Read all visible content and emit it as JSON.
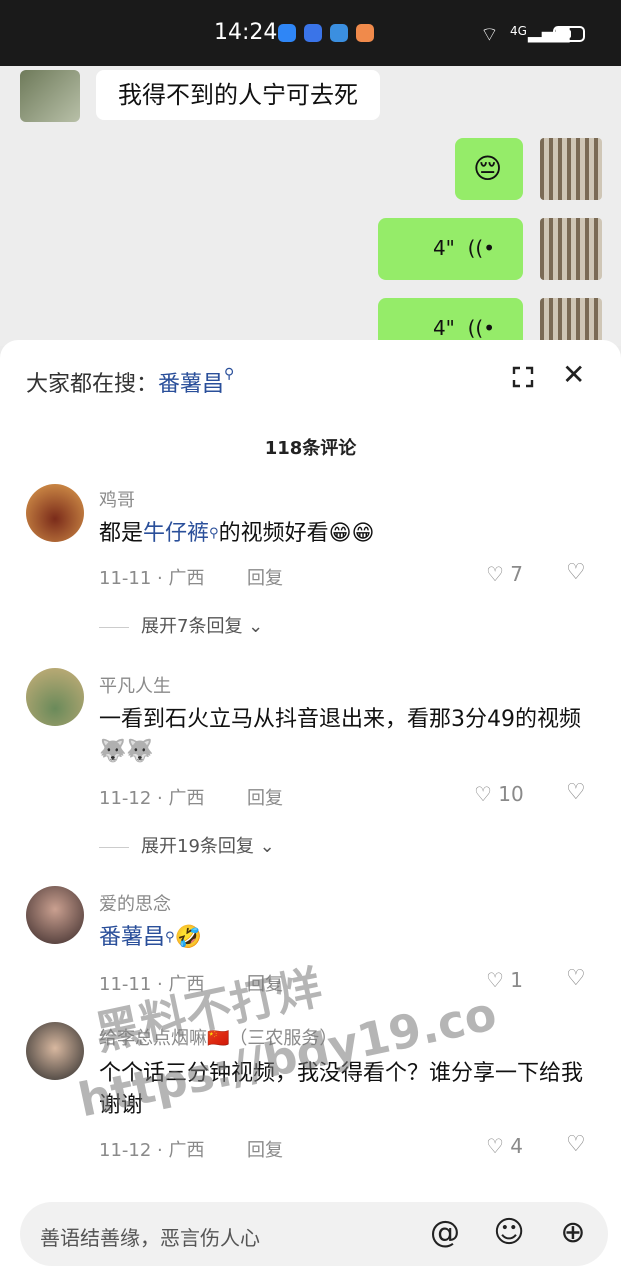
{
  "status_bar": {
    "time": "14:24",
    "network": "4G"
  },
  "chat": {
    "received_text": "我得不到的人宁可去死",
    "sent": [
      {
        "type": "emoji",
        "content": "😔"
      },
      {
        "type": "voice",
        "duration": "4\"",
        "icon": "voice-wave-icon"
      },
      {
        "type": "voice",
        "duration": "4\"",
        "icon": "voice-wave-icon"
      }
    ]
  },
  "sheet": {
    "search_prefix": "大家都在搜：",
    "search_keyword": "番薯昌",
    "comment_count": "118条评论",
    "comments": [
      {
        "name": "鸡哥",
        "text_pre": "都是",
        "keyword": "牛仔裤",
        "text_post": "的视频好看😁😁",
        "date": "11-11 · 广西",
        "reply": "回复",
        "likes": "7",
        "expand": "展开7条回复"
      },
      {
        "name": "平凡人生",
        "text": "一看到石火立马从抖音退出来，看那3分49的视频🐺🐺",
        "date": "11-12 · 广西",
        "reply": "回复",
        "likes": "10",
        "expand": "展开19条回复"
      },
      {
        "name": "爱的思念",
        "keyword": "番薯昌",
        "text_post": "🤣",
        "date": "11-11 · 广西",
        "reply": "回复",
        "likes": "1"
      },
      {
        "name": "给李总点烟嘛🇨🇳（三农服务）",
        "text": "个个话三分钟视频，我没得看个？谁分享一下给我谢谢",
        "date": "11-12 · 广西",
        "reply": "回复",
        "likes": "4"
      }
    ]
  },
  "input": {
    "placeholder": "善语结善缘，恶言伤人心"
  },
  "watermark": {
    "line1": "黑料不打烊",
    "line2": "https://bdy19.co"
  }
}
